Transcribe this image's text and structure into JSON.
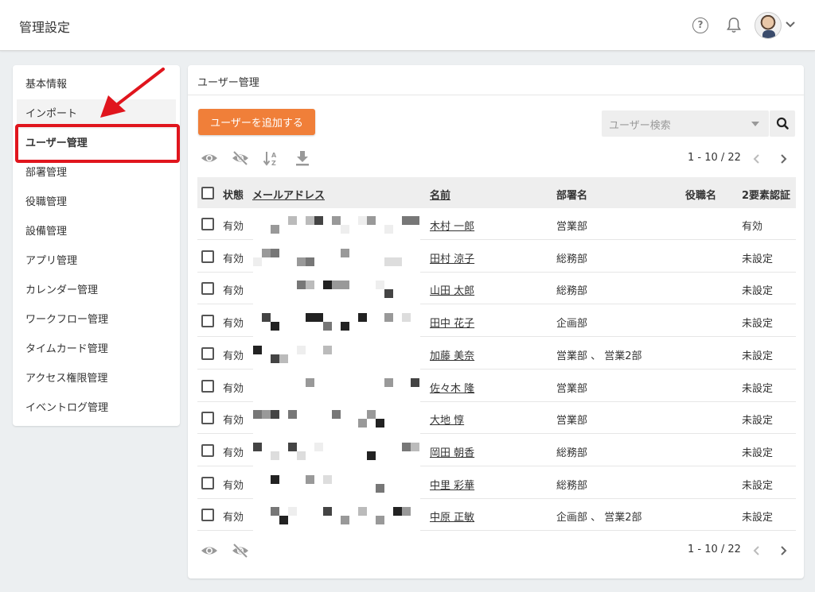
{
  "header": {
    "title": "管理設定",
    "help_icon": "help-circle-icon",
    "bell_icon": "bell-icon"
  },
  "sidebar": {
    "items": [
      {
        "label": "基本情報"
      },
      {
        "label": "インポート"
      },
      {
        "label": "ユーザー管理"
      },
      {
        "label": "部署管理"
      },
      {
        "label": "役職管理"
      },
      {
        "label": "設備管理"
      },
      {
        "label": "アプリ管理"
      },
      {
        "label": "カレンダー管理"
      },
      {
        "label": "ワークフロー管理"
      },
      {
        "label": "タイムカード管理"
      },
      {
        "label": "アクセス権限管理"
      },
      {
        "label": "イベントログ管理"
      }
    ],
    "active_index": 2
  },
  "main": {
    "panel_title": "ユーザー管理",
    "add_button": "ユーザーを追加する",
    "search_placeholder": "ユーザー検索",
    "pager_top": "1 - 10 / 22",
    "pager_bottom": "1 - 10 / 22",
    "accent": "#f07f39"
  },
  "table": {
    "headers": {
      "status": "状態",
      "email": "メールアドレス",
      "name": "名前",
      "dept": "部署名",
      "title": "役職名",
      "twofa": "2要素認証"
    },
    "rows": [
      {
        "status": "有効",
        "name": "木村 一郎",
        "dept": "営業部",
        "title": "",
        "twofa": "有効"
      },
      {
        "status": "有効",
        "name": "田村 涼子",
        "dept": "総務部",
        "title": "",
        "twofa": "未設定"
      },
      {
        "status": "有効",
        "name": "山田 太郎",
        "dept": "総務部",
        "title": "",
        "twofa": "未設定"
      },
      {
        "status": "有効",
        "name": "田中 花子",
        "dept": "企画部",
        "title": "",
        "twofa": "未設定"
      },
      {
        "status": "有効",
        "name": "加藤 美奈",
        "dept": "営業部 、 営業2部",
        "title": "",
        "twofa": "未設定"
      },
      {
        "status": "有効",
        "name": "佐々木 隆",
        "dept": "営業部",
        "title": "",
        "twofa": "未設定"
      },
      {
        "status": "有効",
        "name": "大地 惇",
        "dept": "営業部",
        "title": "",
        "twofa": "未設定"
      },
      {
        "status": "有効",
        "name": "岡田 朝香",
        "dept": "総務部",
        "title": "",
        "twofa": "未設定"
      },
      {
        "status": "有効",
        "name": "中里 彩華",
        "dept": "総務部",
        "title": "",
        "twofa": "未設定"
      },
      {
        "status": "有効",
        "name": "中原 正敏",
        "dept": "企画部 、 営業2部",
        "title": "",
        "twofa": "未設定"
      }
    ]
  }
}
